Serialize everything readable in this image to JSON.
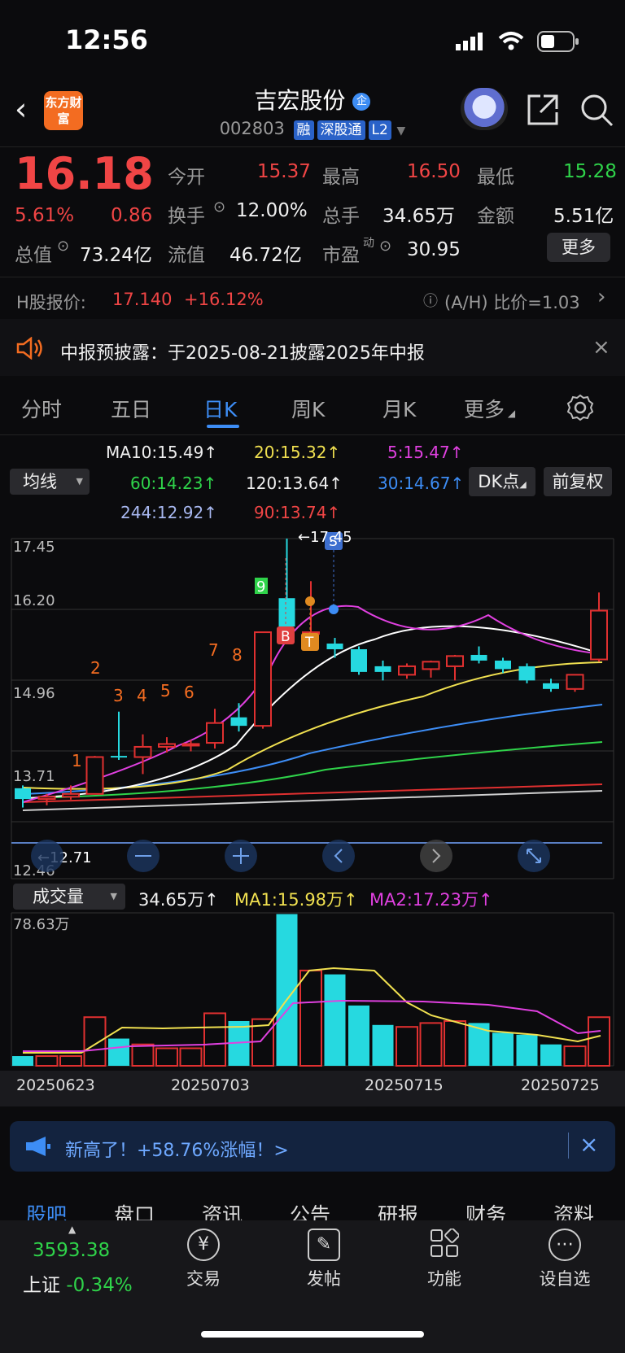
{
  "status_bar": {
    "time": "12:56"
  },
  "header": {
    "logo": "东方财富",
    "stock_name": "吉宏股份",
    "stock_badge": "企",
    "code": "002803",
    "tags": [
      "融",
      "深股通",
      "L2"
    ]
  },
  "quote": {
    "price": "16.18",
    "change_pct": "5.61%",
    "change_amt": "0.86",
    "open_label": "今开",
    "open": "15.37",
    "high_label": "最高",
    "high": "16.50",
    "low_label": "最低",
    "low": "15.28",
    "turnover_label": "换手",
    "turnover": "12.00%",
    "volume_label": "总手",
    "volume": "34.65万",
    "amount_label": "金额",
    "amount": "5.51亿",
    "mktcap_label": "总值",
    "mktcap": "73.24亿",
    "float_label": "流值",
    "float": "46.72亿",
    "pe_label": "市盈",
    "pe_sup": "动",
    "pe": "30.95",
    "more_button": "更多"
  },
  "h_share": {
    "label": "H股报价:",
    "price": "17.140",
    "change": "+16.12%",
    "ah_label": "(A/H) 比价=1.03"
  },
  "notice": {
    "text": "中报预披露：于2025-08-21披露2025年中报"
  },
  "tabs": [
    "分时",
    "五日",
    "日K",
    "周K",
    "月K",
    "更多"
  ],
  "ma": {
    "selector": "均线",
    "ma10": "MA10:15.49↑",
    "ma20": "20:15.32↑",
    "ma5": "5:15.47↑",
    "ma60": "60:14.23↑",
    "ma120": "120:13.64↑",
    "ma30": "30:14.67↑",
    "ma244": "244:12.92↑",
    "ma90": "90:13.74↑",
    "dk_button": "DK点",
    "adjust_button": "前复权"
  },
  "chart_axis": {
    "y1": "17.45",
    "y2": "16.20",
    "y3": "14.96",
    "y4": "13.71",
    "y5": "12.46",
    "high_marker": "←17.45",
    "low_marker": "←12.71"
  },
  "volume_panel": {
    "selector": "成交量",
    "vol": "34.65万↑",
    "ma1": "MA1:15.98万↑",
    "ma2": "MA2:17.23万↑",
    "max": "78.63万",
    "dates": [
      "20250623",
      "20250703",
      "20250715",
      "20250725"
    ]
  },
  "chart_data": {
    "type": "candlestick",
    "ylim": [
      12.46,
      17.45
    ],
    "candles": [
      {
        "o": 13.05,
        "h": 13.1,
        "l": 12.71,
        "c": 12.86
      },
      {
        "o": 12.86,
        "h": 12.95,
        "l": 12.75,
        "c": 12.9
      },
      {
        "o": 12.9,
        "h": 13.1,
        "l": 12.85,
        "c": 12.95
      },
      {
        "o": 12.95,
        "h": 13.62,
        "l": 12.95,
        "c": 13.6
      },
      {
        "o": 13.62,
        "h": 14.4,
        "l": 13.55,
        "c": 13.6
      },
      {
        "o": 13.6,
        "h": 14.0,
        "l": 13.3,
        "c": 13.78
      },
      {
        "o": 13.78,
        "h": 13.95,
        "l": 13.68,
        "c": 13.83
      },
      {
        "o": 13.83,
        "h": 13.9,
        "l": 13.7,
        "c": 13.83
      },
      {
        "o": 13.85,
        "h": 14.45,
        "l": 13.75,
        "c": 14.2
      },
      {
        "o": 14.3,
        "h": 14.55,
        "l": 14.05,
        "c": 14.15
      },
      {
        "o": 14.15,
        "h": 15.8,
        "l": 14.1,
        "c": 15.8
      },
      {
        "o": 16.4,
        "h": 17.45,
        "l": 15.8,
        "c": 15.9
      },
      {
        "o": 15.8,
        "h": 16.7,
        "l": 15.6,
        "c": 15.8
      },
      {
        "o": 15.6,
        "h": 15.7,
        "l": 15.35,
        "c": 15.5
      },
      {
        "o": 15.5,
        "h": 15.55,
        "l": 15.05,
        "c": 15.1
      },
      {
        "o": 15.2,
        "h": 15.3,
        "l": 14.95,
        "c": 15.1
      },
      {
        "o": 15.05,
        "h": 15.25,
        "l": 14.98,
        "c": 15.2
      },
      {
        "o": 15.15,
        "h": 15.3,
        "l": 15.0,
        "c": 15.28
      },
      {
        "o": 15.2,
        "h": 15.4,
        "l": 14.95,
        "c": 15.38
      },
      {
        "o": 15.4,
        "h": 15.55,
        "l": 15.25,
        "c": 15.3
      },
      {
        "o": 15.3,
        "h": 15.35,
        "l": 15.08,
        "c": 15.15
      },
      {
        "o": 15.2,
        "h": 15.25,
        "l": 14.9,
        "c": 14.95
      },
      {
        "o": 14.9,
        "h": 14.98,
        "l": 14.75,
        "c": 14.8
      },
      {
        "o": 14.8,
        "h": 15.05,
        "l": 14.75,
        "c": 15.05
      },
      {
        "o": 15.32,
        "h": 16.5,
        "l": 15.28,
        "c": 16.18
      }
    ],
    "signals": [
      "1",
      "2",
      "3",
      "4",
      "5",
      "6",
      "7",
      "8",
      "9"
    ],
    "trade_marks": [
      "B",
      "T",
      "S"
    ],
    "volume_ylim": [
      0,
      78.63
    ],
    "volumes": [
      5,
      5,
      5,
      25,
      14,
      11,
      9,
      9,
      27,
      23,
      24,
      78,
      49,
      47,
      31,
      21,
      20,
      22,
      23,
      22,
      17,
      16,
      11,
      10,
      25
    ]
  },
  "banner": {
    "text": "新高了！+58.76%涨幅！>"
  },
  "bottom_tabs": [
    "股吧",
    "盘口",
    "资讯",
    "公告",
    "研报",
    "财务",
    "资料"
  ],
  "bottom_nav": {
    "index_value": "3593.38",
    "index_name": "上证",
    "index_change": "-0.34%",
    "items": [
      "交易",
      "发帖",
      "功能",
      "设自选"
    ]
  }
}
